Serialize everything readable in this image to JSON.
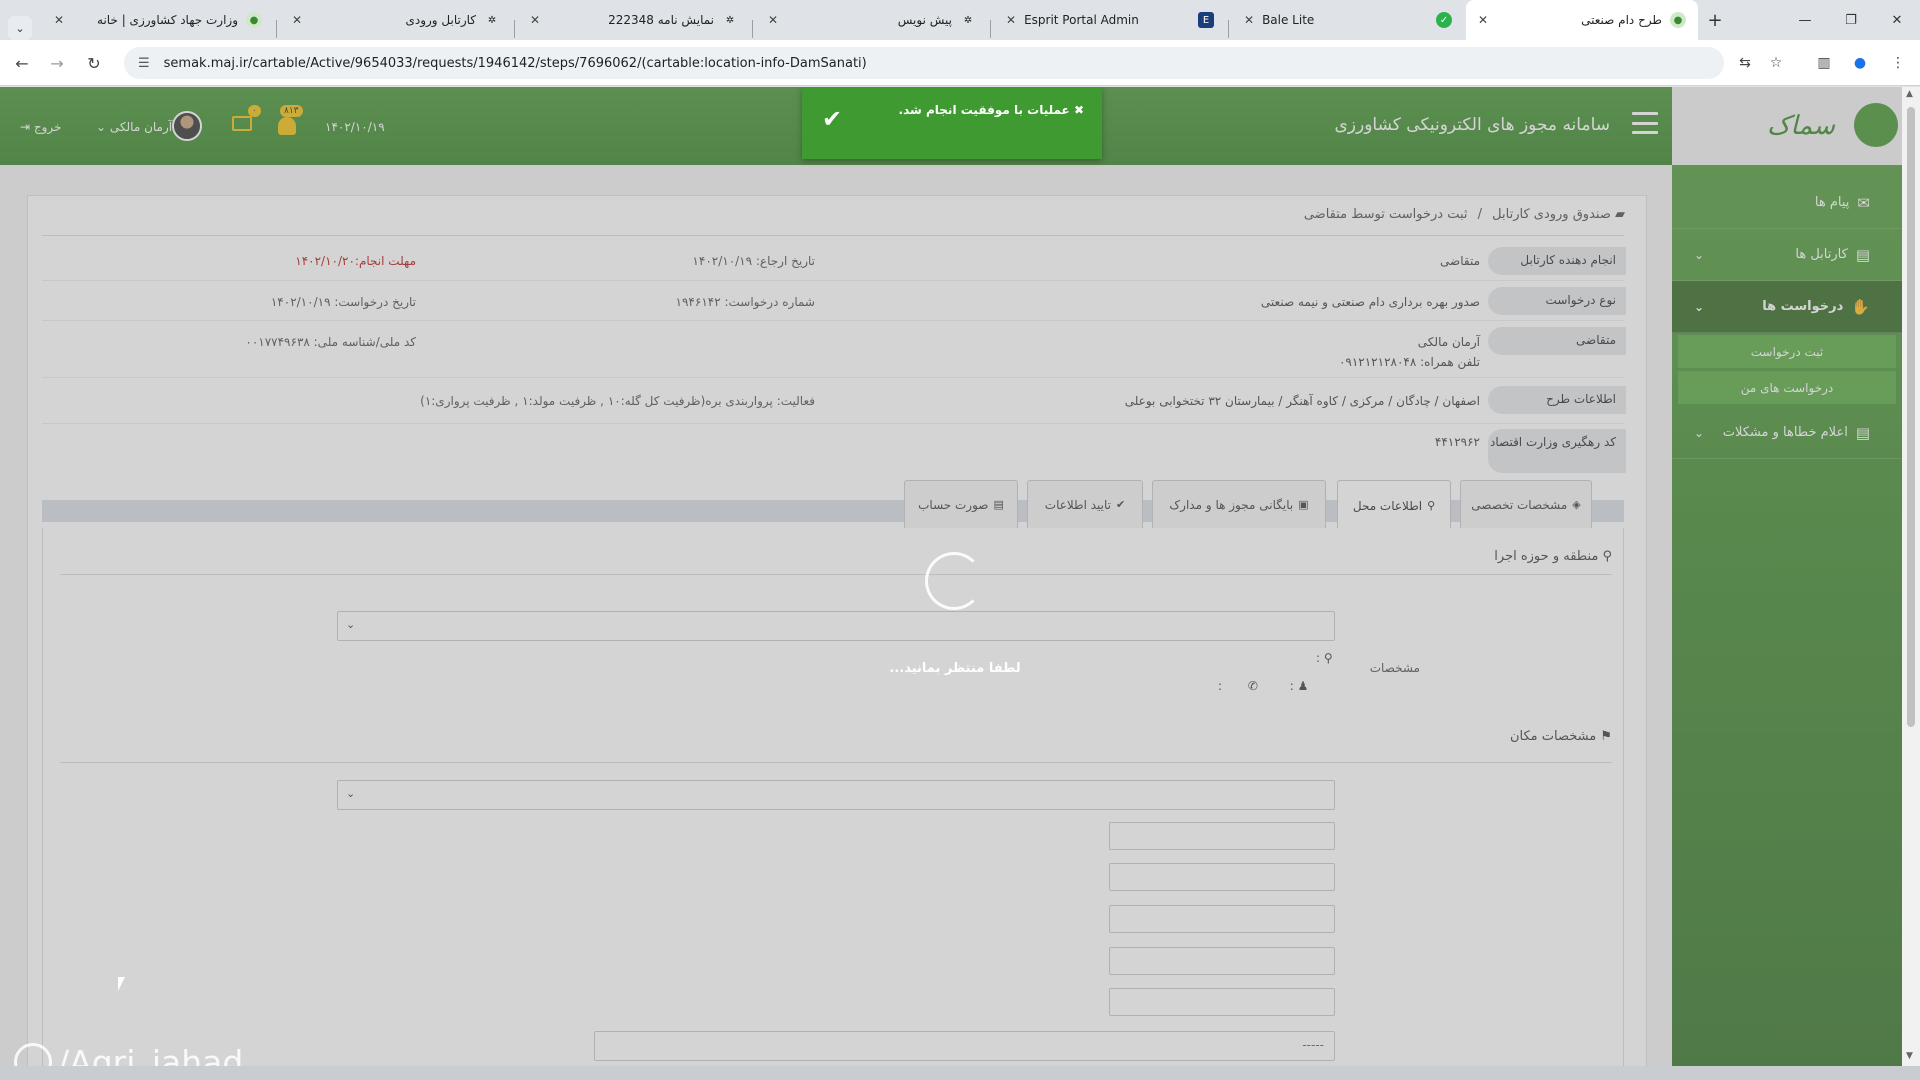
{
  "browser": {
    "tabs": [
      {
        "title": "وزارت جهاد کشاورزی | خانه"
      },
      {
        "title": "کارتابل ورودی"
      },
      {
        "title": "نمایش نامه 222348"
      },
      {
        "title": "پیش نویس"
      },
      {
        "title": "Esprit Portal Admin"
      },
      {
        "title": "Bale Lite"
      },
      {
        "title": "طرح دام صنعتی"
      }
    ],
    "url": "semak.maj.ir/cartable/Active/9654033/requests/1946142/steps/7696062/(cartable:location-info-DamSanati)"
  },
  "header": {
    "system_title": "سامانه مجوز های الکترونیکی کشاورزی",
    "date": "۱۴۰۲/۱۰/۱۹",
    "bell_badge": "۸۱۳",
    "mail_badge": "۰",
    "user_name": "آرمان مالکی",
    "logout_label": "خروج"
  },
  "toast": {
    "message": "عملیات با موفقیت انجام شد."
  },
  "sidebar": {
    "logo_text": "سماک",
    "items": [
      {
        "label": "پیام ها"
      },
      {
        "label": "کارتابل ها"
      },
      {
        "label": "درخواست ها"
      },
      {
        "label": "اعلام خطاها و مشکلات"
      }
    ],
    "sub_items": [
      {
        "label": "ثبت درخواست"
      },
      {
        "label": "درخواست های من"
      }
    ]
  },
  "breadcrumb": {
    "root": "صندوق ورودی کارتابل",
    "separator": "/",
    "current": "ثبت درخواست توسط متقاضی"
  },
  "info": {
    "rows": [
      {
        "label": "انجام دهنده کارتابل",
        "value": "متقاضی"
      },
      {
        "label": "نوع درخواست",
        "value": "صدور بهره برداری دام صنعتی و نیمه صنعتی"
      },
      {
        "label": "متقاضی",
        "value": "آرمان مالکی",
        "sub": "تلفن همراه: ۰۹۱۲۱۲۱۲۸۰۴۸"
      },
      {
        "label": "اطلاعات طرح",
        "value": "اصفهان / چادگان / مرکزی / کاوه آهنگر / بیمارستان ۳۲ تختخوابی بوعلی"
      },
      {
        "label": "کد رهگیری وزارت اقتصاد",
        "value": "۴۴۱۲۹۶۲"
      }
    ],
    "referral_date": "تاریخ ارجاع: ۱۴۰۲/۱۰/۱۹",
    "deadline": "مهلت انجام:۱۴۰۲/۱۰/۲۰",
    "request_number": "شماره درخواست: ۱۹۴۶۱۴۲",
    "request_date": "تاریخ درخواست: ۱۴۰۲/۱۰/۱۹",
    "national_id": "کد ملی/شناسه ملی: ۰۰۱۷۷۴۹۶۳۸",
    "activity": "فعالیت: پرواربندی بره(ظرفیت کل گله:۱۰ , ظرفیت مولد:۱ , ظرفیت پرواری:۱)"
  },
  "tabs": [
    {
      "label": "مشخصات تخصصی"
    },
    {
      "label": "اطلاعات محل"
    },
    {
      "label": "بایگانی مجوز ها و مدارک"
    },
    {
      "label": "تایید اطلاعات"
    },
    {
      "label": "صورت حساب"
    }
  ],
  "location": {
    "region_title": "منطقه و حوزه اجرا",
    "specs_label": "مشخصات",
    "colon": ":",
    "place_title": "مشخصات مکان",
    "wide_placeholder": "-----"
  },
  "loading": {
    "text": "لطفا منتظر بمانید..."
  },
  "watermark": {
    "text": "/Agri_jahad"
  }
}
